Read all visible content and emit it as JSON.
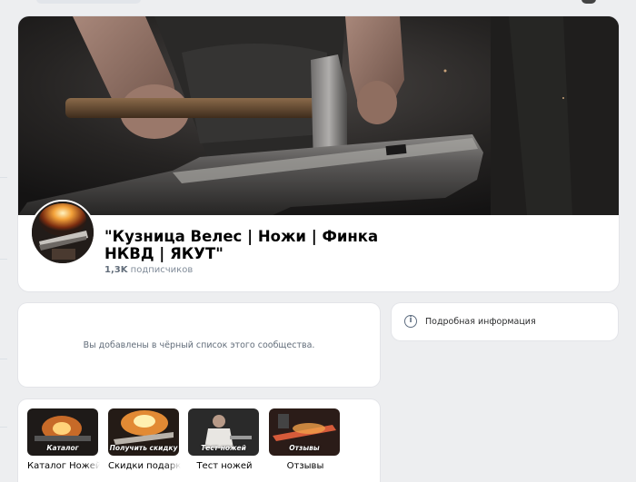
{
  "group": {
    "title": "\"Кузница Велес | Ножи | Финка НКВД | ЯКУТ\"",
    "subscribers_count": "1,3K",
    "subscribers_label": "подписчиков"
  },
  "blacklist": {
    "message": "Вы добавлены в чёрный список этого сообщества."
  },
  "info": {
    "label": "Подробная информация",
    "icon": "info-icon"
  },
  "products": [
    {
      "label": "Каталог Ножей",
      "overlay": "Каталог"
    },
    {
      "label": "Скидки подарки",
      "overlay": "Получить скидку"
    },
    {
      "label": "Тест ножей",
      "overlay": "Тест ножей"
    },
    {
      "label": "Отзывы",
      "overlay": "Отзывы"
    }
  ]
}
